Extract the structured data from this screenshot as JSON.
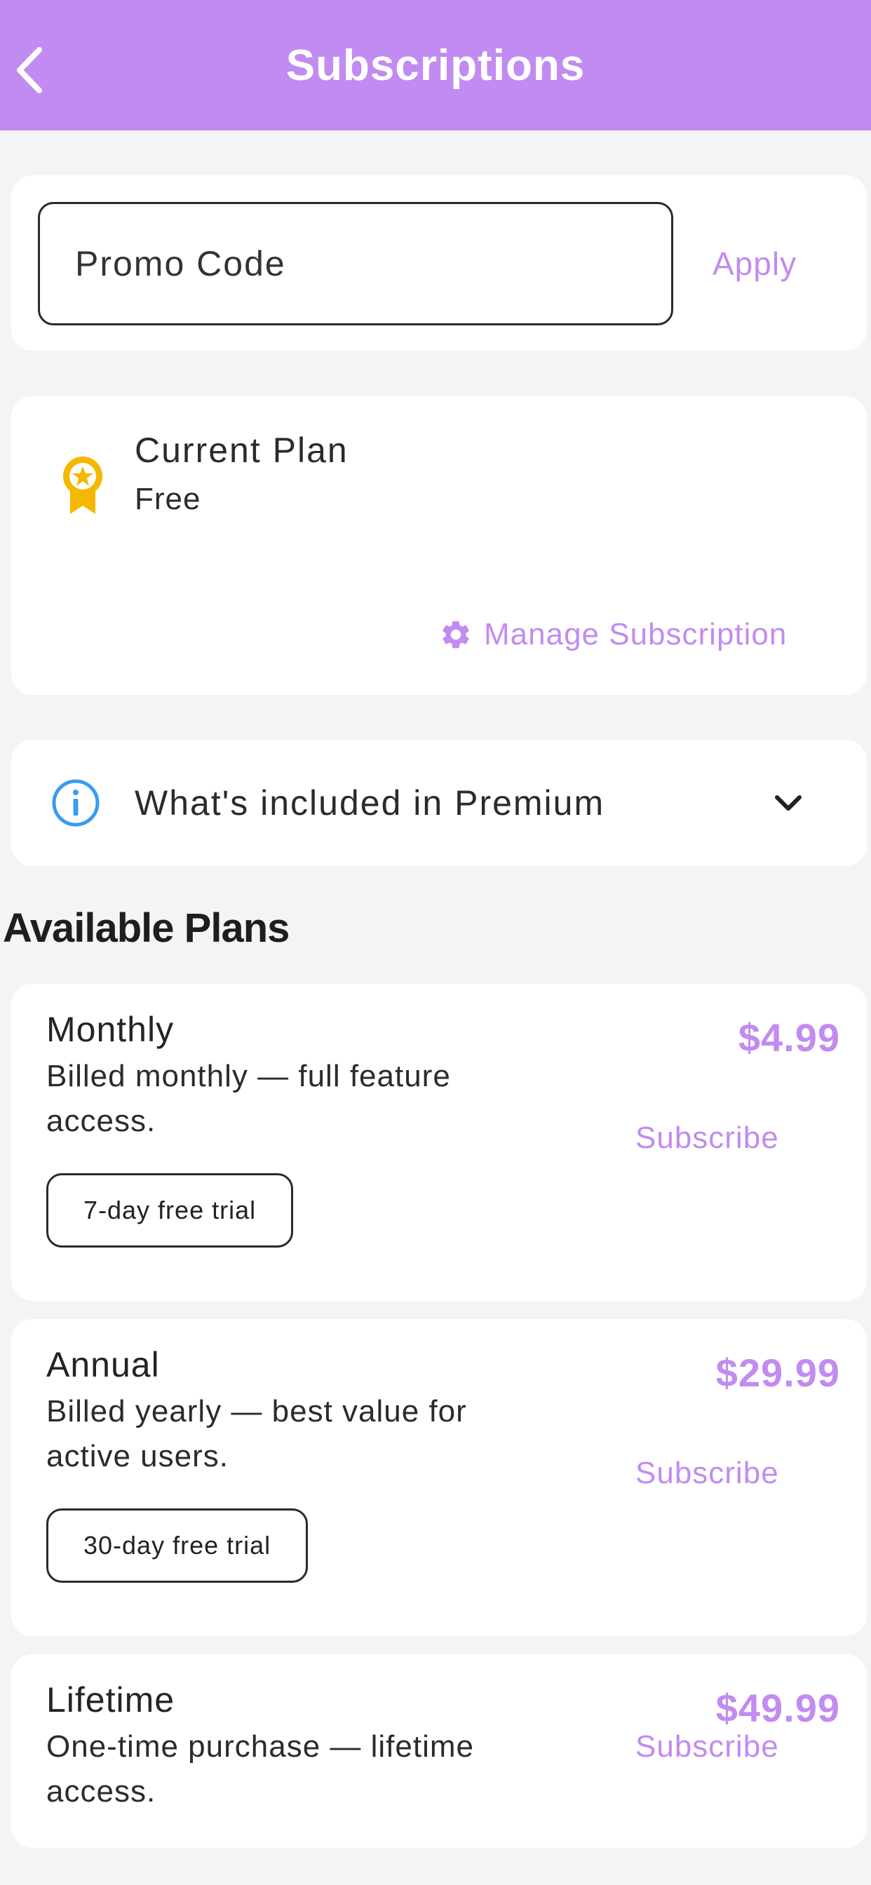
{
  "header": {
    "title": "Subscriptions",
    "back_icon": "chevron-left-icon"
  },
  "promo": {
    "placeholder": "Promo Code",
    "apply_label": "Apply"
  },
  "current_plan": {
    "icon": "medal-icon",
    "label": "Current Plan",
    "value": "Free",
    "manage_icon": "gear-icon",
    "manage_label": "Manage Subscription"
  },
  "premium_info": {
    "icon": "info-icon",
    "label": "What's included in Premium",
    "toggle_icon": "chevron-down-icon"
  },
  "section_title": "Available Plans",
  "plans": [
    {
      "name": "Monthly",
      "description": "Billed monthly — full feature access.",
      "price": "$4.99",
      "subscribe_label": "Subscribe",
      "trial": "7-day free trial"
    },
    {
      "name": "Annual",
      "description": "Billed yearly — best value for active users.",
      "price": "$29.99",
      "subscribe_label": "Subscribe",
      "trial": "30-day free trial"
    },
    {
      "name": "Lifetime",
      "description": "One-time purchase — lifetime access.",
      "price": "$49.99",
      "subscribe_label": "Subscribe"
    }
  ],
  "colors": {
    "accent": "#c28bf1",
    "background": "#f4f4f4",
    "medal": "#f5b800",
    "info": "#3a9bf0"
  }
}
